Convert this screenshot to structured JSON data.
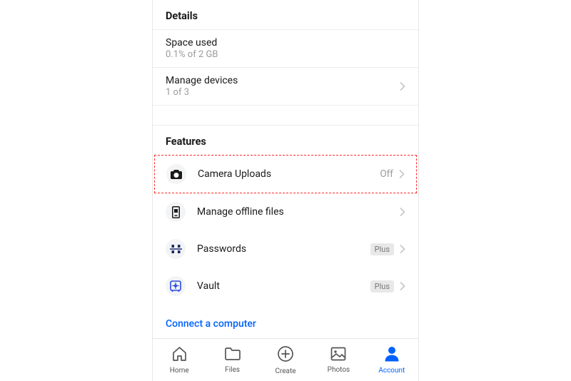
{
  "details": {
    "header": "Details",
    "space_used": {
      "label": "Space used",
      "value": "0.1% of 2 GB"
    },
    "manage_devices": {
      "label": "Manage devices",
      "value": "1 of 3"
    }
  },
  "features": {
    "header": "Features",
    "camera_uploads": {
      "label": "Camera Uploads",
      "value": "Off"
    },
    "offline": {
      "label": "Manage offline files"
    },
    "passwords": {
      "label": "Passwords",
      "badge": "Plus"
    },
    "vault": {
      "label": "Vault",
      "badge": "Plus"
    },
    "connect": "Connect a computer"
  },
  "tabs": {
    "home": "Home",
    "files": "Files",
    "create": "Create",
    "photos": "Photos",
    "account": "Account"
  }
}
